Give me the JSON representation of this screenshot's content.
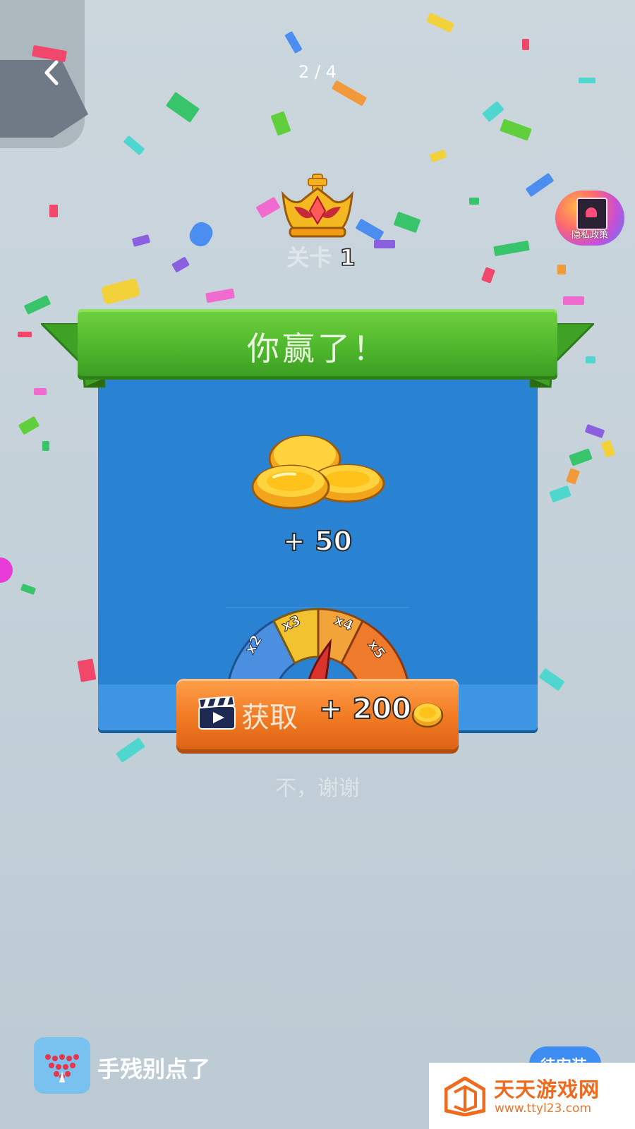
{
  "top_bar": {
    "back_icon": "chevron-left-icon",
    "page_counter": "2 / 4"
  },
  "level": {
    "label": "关卡",
    "number": "1",
    "icon": "crown-icon"
  },
  "privacy": {
    "label": "隐私政策"
  },
  "result": {
    "title": "你赢了！",
    "reward_icon": "coins-icon",
    "reward_amount": "+ 50",
    "multipliers": [
      "x2",
      "x3",
      "x4",
      "x5"
    ]
  },
  "get_button": {
    "icon": "clapperboard-icon",
    "label": "获取",
    "amount": "+ 200",
    "coin_icon": "coin-icon"
  },
  "no_thanks": "不，谢谢",
  "ad_bar": {
    "app_name": "手残别点了",
    "install_label": "待安装"
  },
  "watermark": {
    "title": "天天游戏网",
    "url": "www.ttyl23.com"
  },
  "colors": {
    "panel_blue": "#2a82d3",
    "ribbon_green": "#4cb52b",
    "button_orange": "#f17a23",
    "gauge_blue": "#4a8fe0",
    "gauge_yellow": "#f2c231",
    "gauge_orange": "#ef8a2c",
    "needle_red": "#d9342b",
    "watermark_orange": "#ef6a1d"
  }
}
